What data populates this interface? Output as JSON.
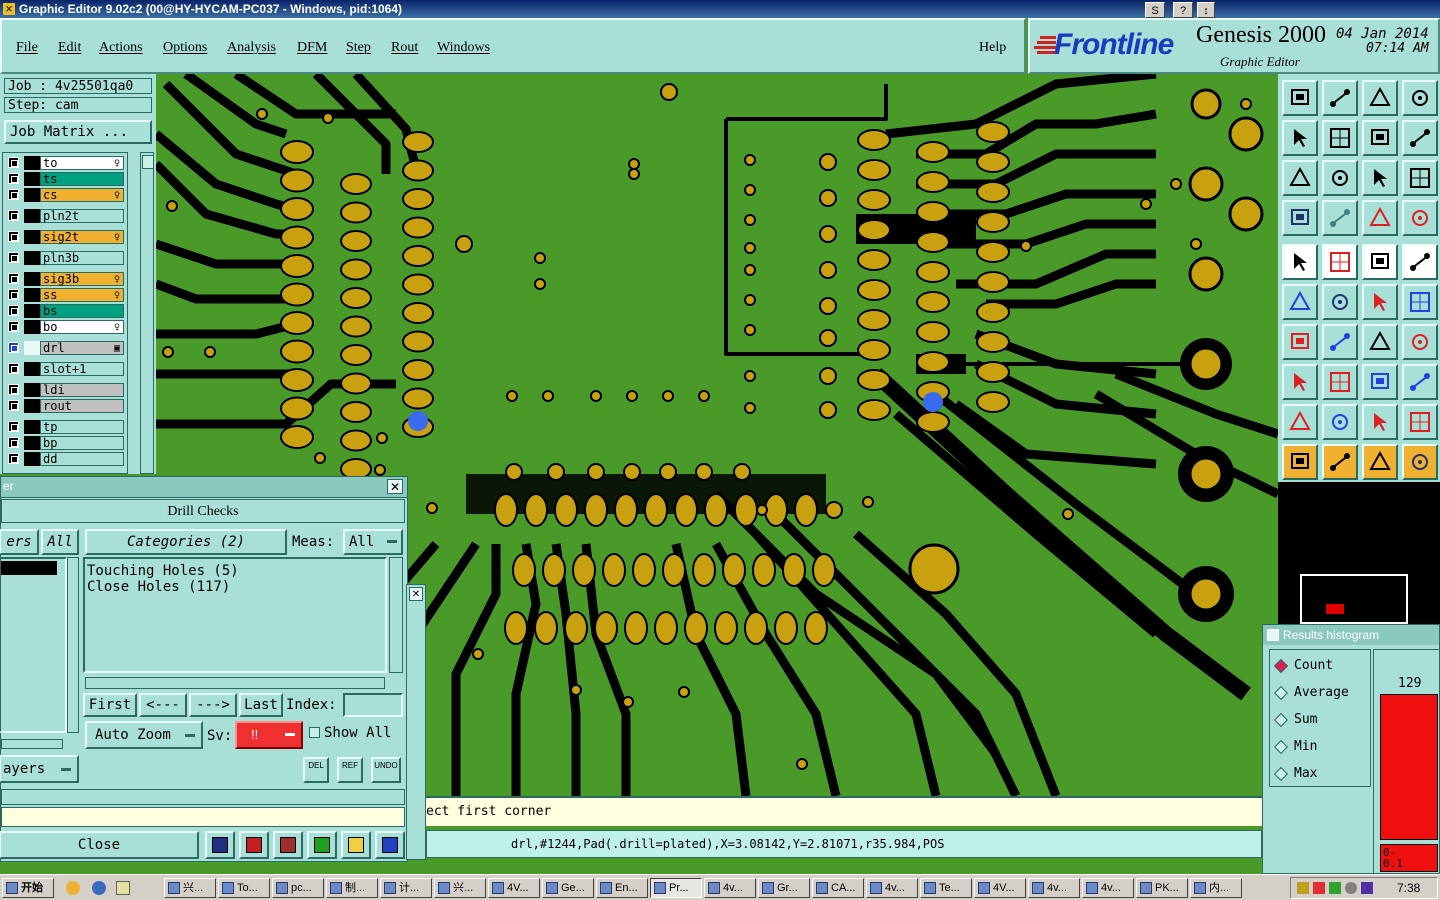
{
  "window": {
    "title": "Graphic Editor 9.02c2 (00@HY-HYCAM-PC037 - Windows, pid:1064)",
    "controls": [
      "S",
      "?",
      "↕"
    ]
  },
  "menu": {
    "items": [
      "File",
      "Edit",
      "Actions",
      "Options",
      "Analysis",
      "DFM",
      "Step",
      "Rout",
      "Windows"
    ],
    "help": "Help"
  },
  "brand": {
    "logo": "Frontline",
    "product": "Genesis 2000",
    "subtitle": "Graphic Editor",
    "date": "04 Jan 2014",
    "time": "07:14 AM"
  },
  "job": {
    "job_label": "Job : 4v25501qa0",
    "step_label": "Step: cam",
    "matrix_button": "Job Matrix ..."
  },
  "layers": [
    {
      "name": "to",
      "color": "#ffffff",
      "marker": "♀"
    },
    {
      "name": "ts",
      "color": "#00a080",
      "marker": ""
    },
    {
      "name": "cs",
      "color": "#f0b030",
      "marker": "♀"
    },
    {
      "name": "pln2t",
      "color": "#a8e0d8",
      "marker": ""
    },
    {
      "name": "sig2t",
      "color": "#f0b030",
      "marker": "♀"
    },
    {
      "name": "pln3b",
      "color": "#a8e0d8",
      "marker": ""
    },
    {
      "name": "sig3b",
      "color": "#f0b030",
      "marker": "♀"
    },
    {
      "name": "ss",
      "color": "#f0b030",
      "marker": "♀"
    },
    {
      "name": "bs",
      "color": "#00a080",
      "marker": ""
    },
    {
      "name": "bo",
      "color": "#ffffff",
      "marker": "♀"
    },
    {
      "name": "drl",
      "color": "#c0c0c0",
      "marker": "▣"
    },
    {
      "name": "slot+1",
      "color": "#a8e0d8",
      "marker": ""
    },
    {
      "name": "ldi",
      "color": "#c0c0c0",
      "marker": ""
    },
    {
      "name": "rout",
      "color": "#c0c0c0",
      "marker": ""
    },
    {
      "name": "tp",
      "color": "#a8e0d8",
      "marker": ""
    },
    {
      "name": "bp",
      "color": "#a8e0d8",
      "marker": ""
    },
    {
      "name": "dd",
      "color": "#a8e0d8",
      "marker": ""
    }
  ],
  "dialog": {
    "title_fragment": "er",
    "header": "Drill Checks",
    "layers_tab": "ers",
    "all_button": "All",
    "categories_button": "Categories (2)",
    "meas_label": "Meas:",
    "meas_value": "All",
    "categories": [
      "Touching Holes (5)",
      "Close Holes (117)"
    ],
    "nav": {
      "first": "First",
      "prev": "<---",
      "next": "--->",
      "last": "Last",
      "index_label": "Index:",
      "index_value": ""
    },
    "auto_zoom": "Auto Zoom",
    "sv_label": "Sv:",
    "sv_value": "!!",
    "show_all": "Show All",
    "small_buttons": [
      "DEL",
      "REF",
      "UNDO"
    ],
    "layers_dropdown": "ayers",
    "close": "Close"
  },
  "status": {
    "prompt": "ect first corner",
    "coords": "drl,#1244,Pad(.drill=plated),X=3.08142,Y=2.81071,r35.984,POS"
  },
  "histogram": {
    "title": "Results histogram",
    "options": [
      "Count",
      "Average",
      "Sum",
      "Min",
      "Max"
    ],
    "selected": "Count",
    "bar_value": "129",
    "range_label": "0-\n0.1"
  },
  "taskbar": {
    "start": "开始",
    "tasks": [
      "兴...",
      "To...",
      "pc...",
      "制...",
      "计...",
      "兴...",
      "4V...",
      "Ge...",
      "En...",
      "Pr...",
      "4v...",
      "Gr...",
      "CA...",
      "4v...",
      "Te...",
      "4V...",
      "4v...",
      "4v...",
      "PK...",
      "内..."
    ],
    "active_task": "Pr...",
    "clock": "7:38"
  },
  "colors": {
    "copper": "#4a9a2a",
    "pad": "#c8a010",
    "panel": "#a8e0d8",
    "highlight_blue": "#3a6af0"
  }
}
